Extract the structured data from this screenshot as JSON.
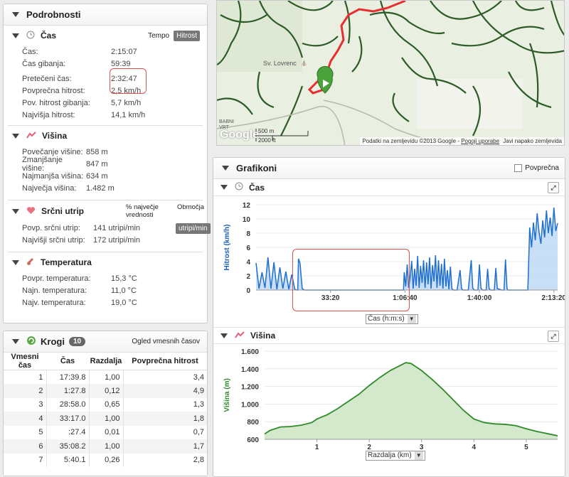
{
  "details": {
    "title": "Podrobnosti",
    "time": {
      "title": "Čas",
      "tab_tempo": "Tempo",
      "tab_speed": "Hitrost",
      "rows": [
        {
          "label": "Čas:",
          "value": "2:15:07"
        },
        {
          "label": "Čas gibanja:",
          "value": "59:39"
        },
        {
          "label": "Pretečeni čas:",
          "value": "2:32:47"
        },
        {
          "label": "Povprečna hitrost:",
          "value": "2,5 km/h"
        },
        {
          "label": "Pov. hitrost gibanja:",
          "value": "5,7 km/h"
        },
        {
          "label": "Najvišja hitrost:",
          "value": "14,1 km/h"
        }
      ]
    },
    "elevation": {
      "title": "Višina",
      "rows": [
        {
          "label": "Povečanje višine:",
          "value": "858 m"
        },
        {
          "label": "Zmanjšanje višine:",
          "value": "847 m"
        },
        {
          "label": "Najmanjša višina:",
          "value": "634 m"
        },
        {
          "label": "Največja višina:",
          "value": "1.482 m"
        }
      ]
    },
    "heart": {
      "title": "Srčni utrip",
      "col_pct": "% največje vrednosti",
      "col_zones": "Območja",
      "unit_button": "utripi/min",
      "rows": [
        {
          "label": "Povp. srčni utrip:",
          "value": "141 utripi/min"
        },
        {
          "label": "Najvišji srčni utrip:",
          "value": "172 utripi/min"
        }
      ]
    },
    "temperature": {
      "title": "Temperatura",
      "rows": [
        {
          "label": "Povpr. temperatura:",
          "value": "15,3 °C"
        },
        {
          "label": "Najn. temperatura:",
          "value": "11,0 °C"
        },
        {
          "label": "Najv. temperatura:",
          "value": "19,0 °C"
        }
      ]
    }
  },
  "laps": {
    "title": "Krogi",
    "count": "10",
    "view_link": "Ogled vmesnih časov",
    "headers": [
      "Vmesni čas",
      "Čas",
      "Razdalja",
      "Povprečna hitrost"
    ],
    "rows": [
      [
        "1",
        "17:39.8",
        "1,00",
        "3,4"
      ],
      [
        "2",
        "1:27.8",
        "0,12",
        "4,9"
      ],
      [
        "3",
        "28:58.0",
        "0,65",
        "1,3"
      ],
      [
        "4",
        "33:17.0",
        "1,00",
        "1,8"
      ],
      [
        "5",
        ":27.4",
        "0,01",
        "0,7"
      ],
      [
        "6",
        "35:08.2",
        "1,00",
        "1,7"
      ],
      [
        "7",
        "5:40.1",
        "0,26",
        "2,8"
      ]
    ]
  },
  "map": {
    "place_label": "Sv. Lovrenc",
    "corner_label": "BABNI VRT",
    "scale_m": "500 m",
    "scale_ft": "2000 ft",
    "logo": "Google",
    "attribution": "Podatki na zemljevidu ©2013 Google -",
    "terms_link": "Pogoji uporabe",
    "report_link": "Javi napako zemljevida"
  },
  "charts": {
    "title": "Grafikoni",
    "avg_checkbox": "Povprečna",
    "speed_title": "Čas",
    "elev_title": "Višina",
    "speed_select": "Čas (h:m:s)",
    "elev_select": "Razdalja (km)"
  },
  "chart_data": [
    {
      "type": "area",
      "ylabel": "Hitrost (km/h)",
      "ylim": [
        0,
        12
      ],
      "yticks": [
        "0",
        "2",
        "4",
        "6",
        "8",
        "10",
        "12"
      ],
      "xticks": [
        "33:20",
        "1:06:40",
        "1:40:00",
        "2:13:20"
      ],
      "x_domain": [
        0,
        8100
      ],
      "xtick_seconds": [
        2000,
        4000,
        6000,
        8000
      ],
      "x": [
        0,
        80,
        160,
        240,
        320,
        400,
        480,
        560,
        640,
        720,
        800,
        880,
        960,
        1040,
        1100,
        1120,
        1140,
        1180,
        1240,
        1300,
        1320,
        1340,
        3000,
        3960,
        3980,
        4020,
        4060,
        4100,
        4140,
        4180,
        4220,
        4260,
        4300,
        4340,
        4380,
        4420,
        4460,
        4500,
        4540,
        4580,
        4620,
        4660,
        4700,
        4740,
        4780,
        4820,
        4860,
        4900,
        4940,
        4980,
        5020,
        5060,
        5100,
        5140,
        5180,
        5220,
        5260,
        5300,
        5400,
        5480,
        5520,
        5560,
        5700,
        5780,
        5820,
        5860,
        5960,
        6000,
        6040,
        6080,
        6180,
        6220,
        6260,
        6300,
        6400,
        6440,
        6480,
        6600,
        6660,
        6700,
        6740,
        6760,
        7300,
        7350,
        7400,
        7450,
        7500,
        7550,
        7600,
        7650,
        7700,
        7750,
        7800,
        7850,
        7900,
        7950,
        8000,
        8050,
        8100
      ],
      "values": [
        3.8,
        0.2,
        2.5,
        0.3,
        4.6,
        0.2,
        3.9,
        0.1,
        3.2,
        0.2,
        2.6,
        0.1,
        2.2,
        0.1,
        0,
        0,
        4.4,
        3.8,
        0.2,
        0,
        0,
        0,
        0,
        0,
        2.5,
        0.5,
        3.6,
        0.3,
        1.8,
        4.1,
        0.2,
        3.0,
        0.6,
        4.8,
        0.3,
        3.4,
        1.0,
        4.2,
        0.3,
        3.9,
        0.8,
        4.6,
        0.2,
        3.5,
        1.2,
        4.9,
        0.3,
        4.2,
        0.6,
        3.7,
        0.2,
        4.4,
        0.5,
        2.8,
        0.1,
        3.3,
        0.2,
        0,
        0,
        2.8,
        0.2,
        0,
        0,
        4.2,
        0.3,
        0,
        0,
        3.6,
        0.3,
        0,
        0,
        3.0,
        0.2,
        0,
        0,
        3.1,
        0.2,
        0,
        0,
        4.3,
        0.3,
        0,
        0,
        8.8,
        6.0,
        9.5,
        7.0,
        10.8,
        8.2,
        6.5,
        9.8,
        7.4,
        11.2,
        8.0,
        10.2,
        7.6,
        11.6,
        8.3,
        9.4
      ]
    },
    {
      "type": "area",
      "ylabel": "Višina (m)",
      "ylim": [
        600,
        1600
      ],
      "yticks": [
        "600",
        "800",
        "1.000",
        "1.200",
        "1.400",
        "1.600"
      ],
      "xticks": [
        "1",
        "2",
        "3",
        "4",
        "5"
      ],
      "x": [
        0,
        0.1,
        0.3,
        0.5,
        0.7,
        0.9,
        1.0,
        1.2,
        1.4,
        1.6,
        1.8,
        2.0,
        2.2,
        2.4,
        2.6,
        2.7,
        2.8,
        3.0,
        3.2,
        3.4,
        3.6,
        3.8,
        4.0,
        4.2,
        4.4,
        4.6,
        4.8,
        5.0,
        5.2,
        5.4,
        5.6
      ],
      "values": [
        660,
        700,
        740,
        745,
        760,
        790,
        830,
        880,
        950,
        1030,
        1110,
        1210,
        1300,
        1380,
        1440,
        1470,
        1460,
        1380,
        1280,
        1170,
        1050,
        930,
        830,
        790,
        775,
        770,
        755,
        720,
        690,
        665,
        640
      ],
      "xlim": [
        0,
        5.6
      ]
    }
  ]
}
